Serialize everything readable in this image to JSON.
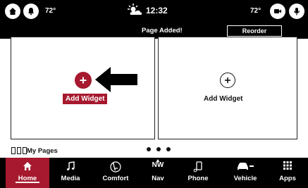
{
  "status": {
    "temp_left": "72°",
    "time": "12:32",
    "temp_right": "72°"
  },
  "notice": {
    "text": "Page Added!",
    "reorder_label": "Reorder"
  },
  "widgets": {
    "left_label": "Add Widget",
    "right_label": "Add Widget"
  },
  "pages": {
    "label": "My Pages"
  },
  "nav": {
    "items": [
      {
        "label": "Home",
        "icon": "home-icon"
      },
      {
        "label": "Media",
        "icon": "music-note-icon"
      },
      {
        "label": "Comfort",
        "icon": "seat-climate-icon"
      },
      {
        "label": "Nav",
        "icon": "compass-icon",
        "heading": "NW"
      },
      {
        "label": "Phone",
        "icon": "phone-icon"
      },
      {
        "label": "Vehicle",
        "icon": "car-icon"
      },
      {
        "label": "Apps",
        "icon": "apps-grid-icon"
      }
    ]
  },
  "colors": {
    "accent": "#a6192e",
    "bar": "#000000"
  }
}
